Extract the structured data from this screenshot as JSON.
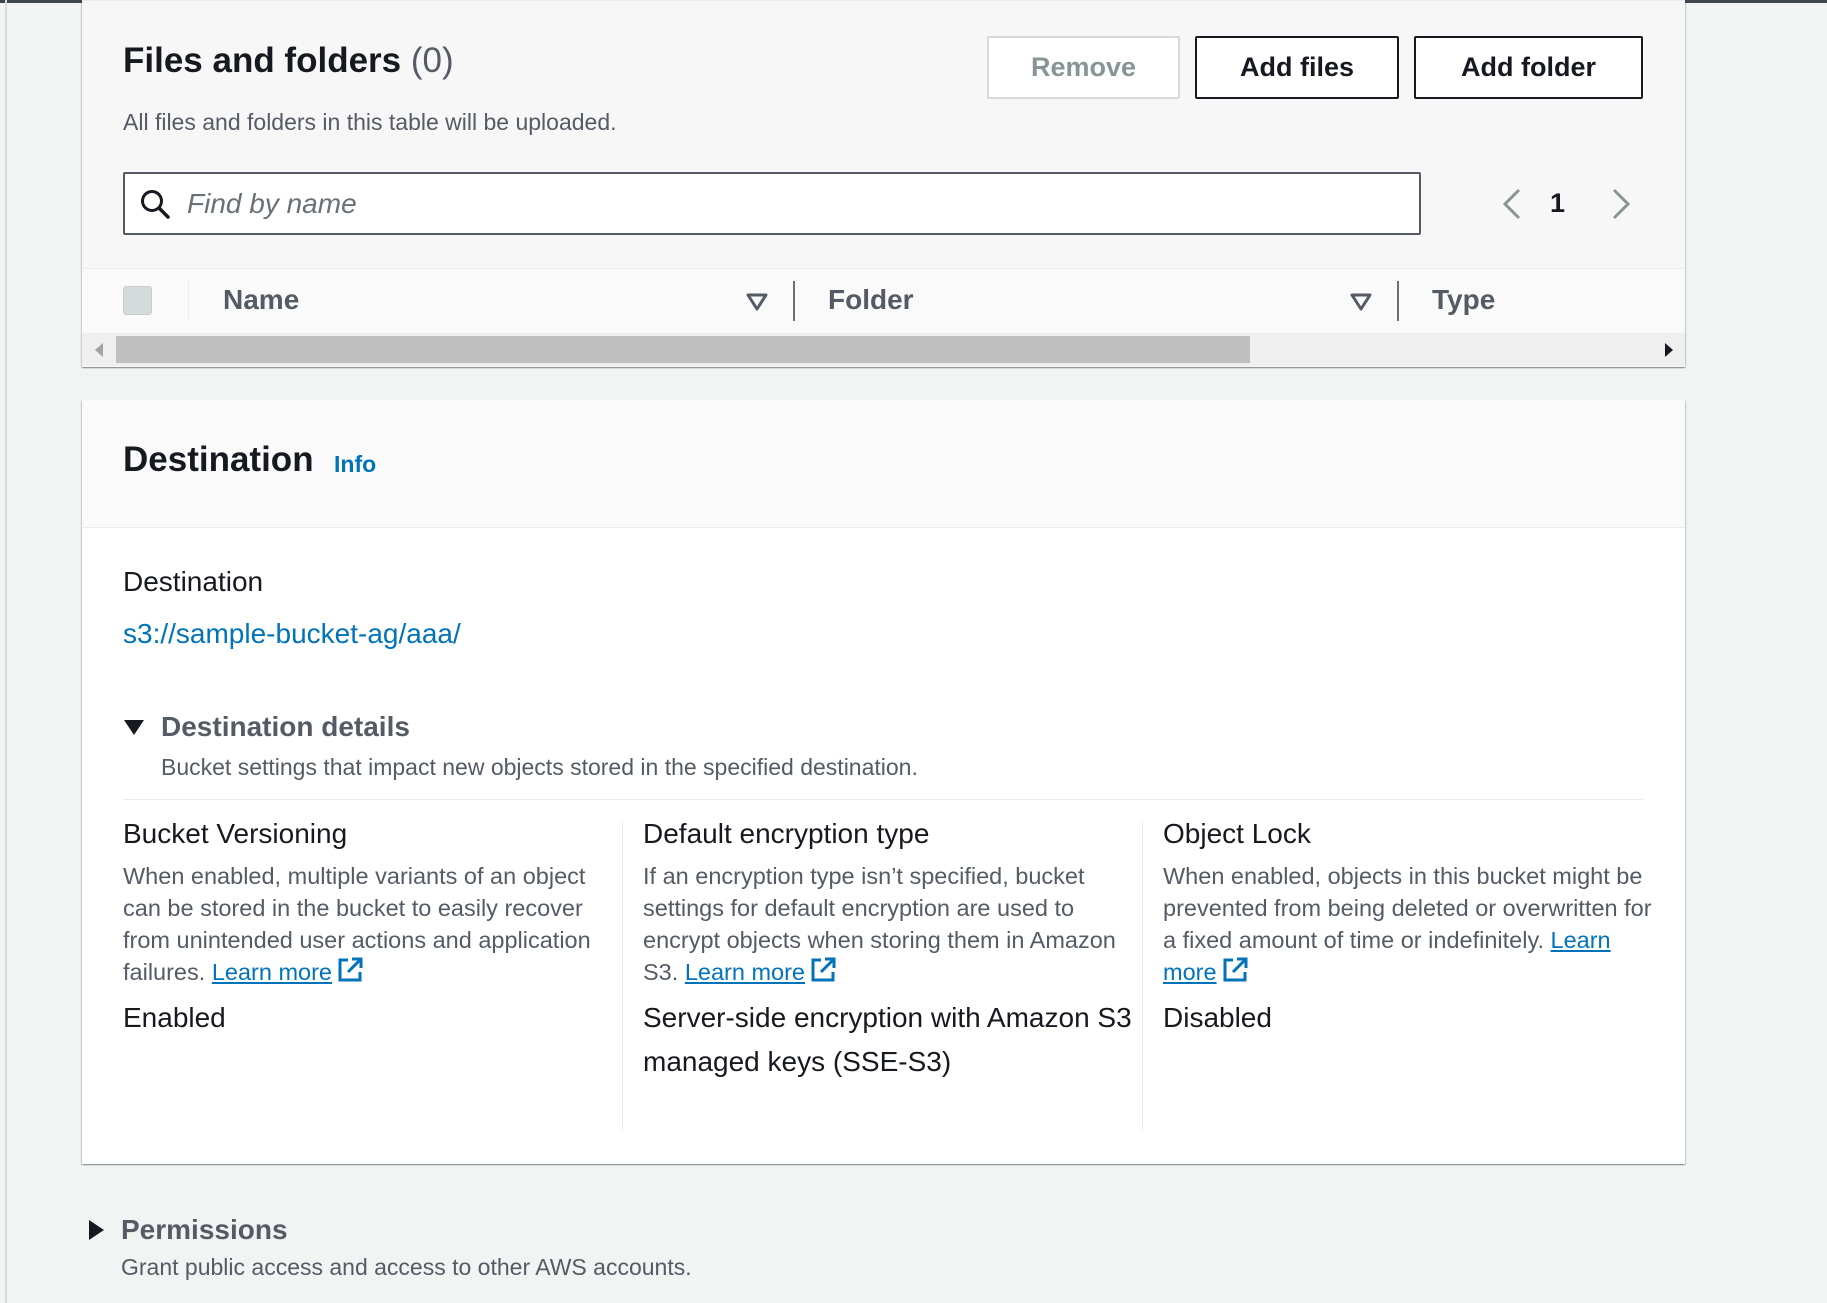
{
  "files_panel": {
    "title": "Files and folders",
    "count": "(0)",
    "description": "All files and folders in this table will be uploaded.",
    "buttons": {
      "remove": "Remove",
      "add_files": "Add files",
      "add_folder": "Add folder"
    },
    "search": {
      "placeholder": "Find by name",
      "value": ""
    },
    "pagination": {
      "current_page": "1"
    },
    "columns": [
      "Name",
      "Folder",
      "Type"
    ]
  },
  "destination_panel": {
    "title": "Destination",
    "info_link": "Info",
    "destination_label": "Destination",
    "destination_url": "s3://sample-bucket-ag/aaa/",
    "details": {
      "title": "Destination details",
      "description": "Bucket settings that impact new objects stored in the specified destination.",
      "columns": [
        {
          "title": "Bucket Versioning",
          "description": "When enabled, multiple variants of an object can be stored in the bucket to easily recover from unintended user actions and application failures.",
          "learn_more": "Learn more",
          "value": "Enabled"
        },
        {
          "title": "Default encryption type",
          "description": "If an encryption type isn’t specified, bucket settings for default encryption are used to encrypt objects when storing them in Amazon S3.",
          "learn_more": "Learn more",
          "value": "Server-side encryption with Amazon S3 managed keys (SSE-S3)"
        },
        {
          "title": "Object Lock",
          "description": "When enabled, objects in this bucket might be prevented from being deleted or overwritten for a fixed amount of time or indefinitely.",
          "learn_more": "Learn more",
          "value": "Disabled"
        }
      ]
    }
  },
  "permissions": {
    "title": "Permissions",
    "description": "Grant public access and access to other AWS accounts."
  },
  "colors": {
    "link": "#0073bb",
    "text": "#16191f",
    "muted": "#545b64"
  }
}
